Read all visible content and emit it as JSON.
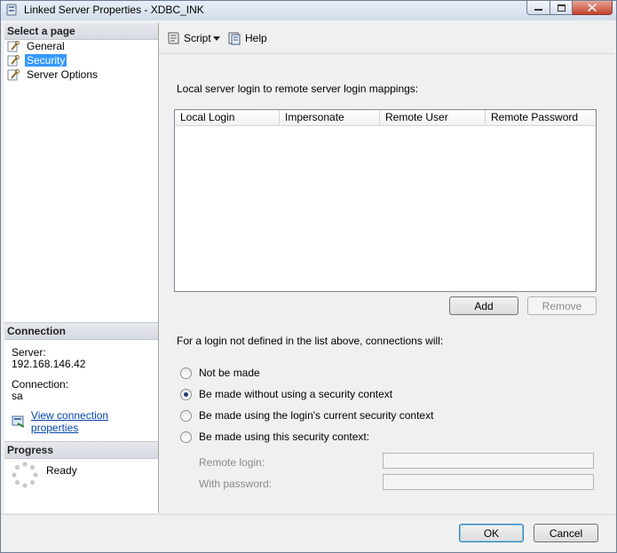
{
  "window": {
    "title": "Linked Server Properties - XDBC_INK",
    "buttons": [
      "minimize",
      "maximize",
      "close"
    ]
  },
  "sidebar": {
    "select_page_header": "Select a page",
    "items": [
      {
        "label": "General",
        "icon": "wrench-page-icon",
        "selected": false
      },
      {
        "label": "Security",
        "icon": "wrench-page-icon",
        "selected": true
      },
      {
        "label": "Server Options",
        "icon": "wrench-page-icon",
        "selected": false
      }
    ],
    "connection_header": "Connection",
    "server_label": "Server:",
    "server_value": "192.168.146.42",
    "connection_label": "Connection:",
    "connection_value": "sa",
    "view_connection_link": "View connection properties",
    "progress_header": "Progress",
    "progress_status": "Ready"
  },
  "toolbar": {
    "script_label": "Script",
    "help_label": "Help"
  },
  "security": {
    "mappings_instruction": "Local server login to remote server login mappings:",
    "columns": [
      "Local Login",
      "Impersonate",
      "Remote User",
      "Remote Password"
    ],
    "rows": [],
    "add_label": "Add",
    "remove_label": "Remove",
    "undefined_login_instruction": "For a login not defined in the list above, connections will:",
    "options": [
      {
        "label": "Not be made",
        "checked": false
      },
      {
        "label": "Be made without using a security context",
        "checked": true
      },
      {
        "label": "Be made using the login's current security context",
        "checked": false
      },
      {
        "label": "Be made using this security context:",
        "checked": false
      }
    ],
    "remote_login_label": "Remote login:",
    "remote_login_value": "",
    "with_password_label": "With password:",
    "with_password_value": ""
  },
  "footer": {
    "ok_label": "OK",
    "cancel_label": "Cancel"
  },
  "colors": {
    "selection": "#3399ff",
    "link": "#0645ad",
    "window_bg": "#f0f0f0"
  }
}
